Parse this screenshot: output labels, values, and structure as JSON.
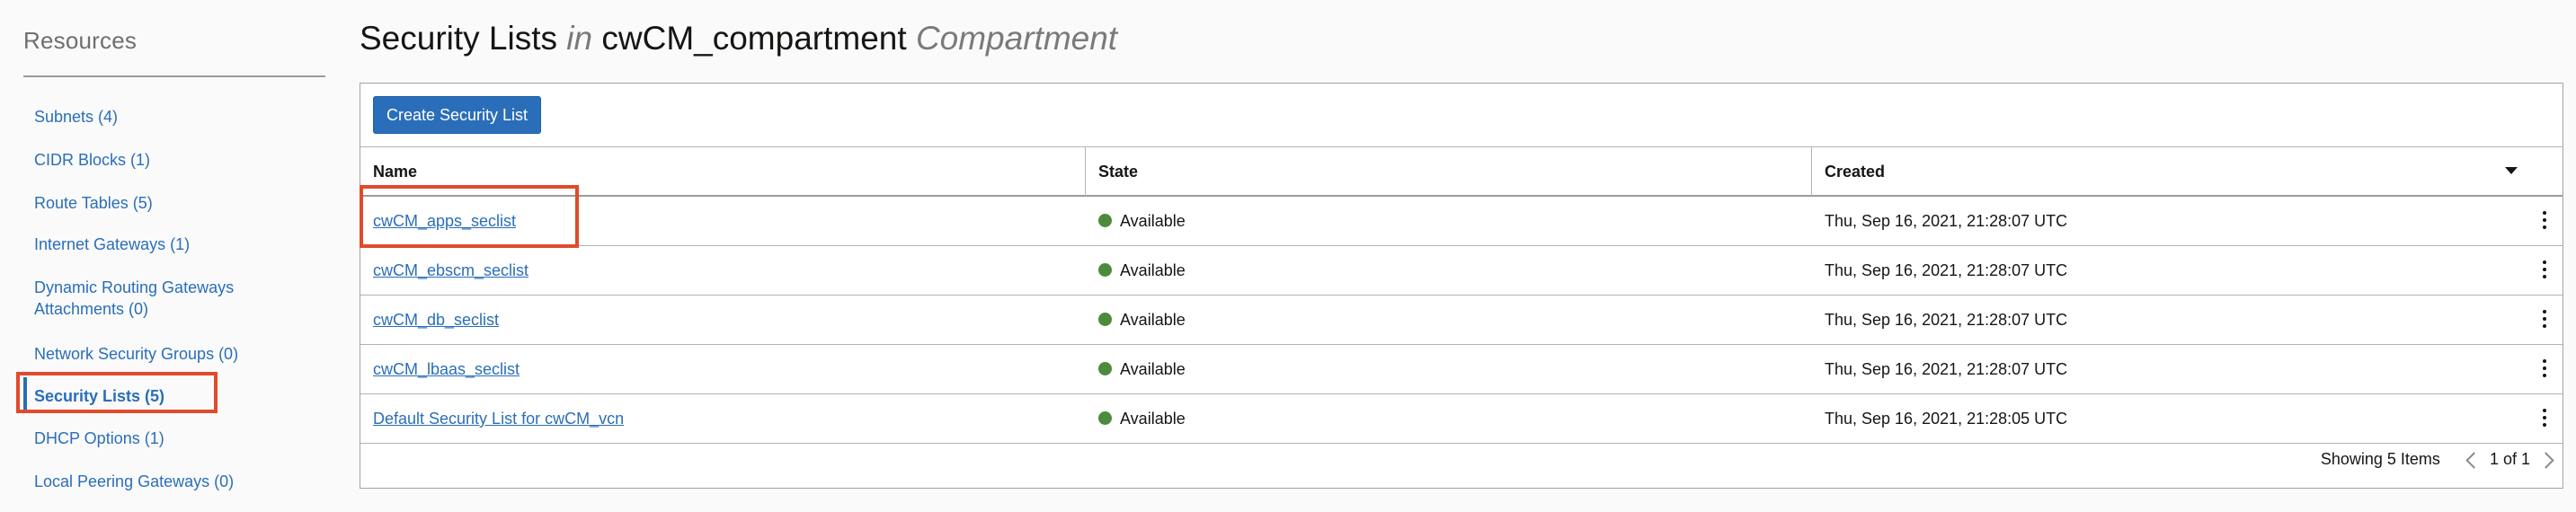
{
  "sidebar": {
    "title": "Resources",
    "items": [
      {
        "label": "Subnets (4)"
      },
      {
        "label": "CIDR Blocks (1)"
      },
      {
        "label": "Route Tables (5)"
      },
      {
        "label": "Internet Gateways (1)"
      },
      {
        "label": "Dynamic Routing Gateways Attachments (0)"
      },
      {
        "label": "Network Security Groups (0)"
      },
      {
        "label": "Security Lists (5)"
      },
      {
        "label": "DHCP Options (1)"
      },
      {
        "label": "Local Peering Gateways (0)"
      }
    ],
    "active_index": 6
  },
  "page": {
    "title_main": "Security Lists",
    "title_in": "in",
    "title_compartment": "cwCM_compartment",
    "title_suffix": "Compartment"
  },
  "toolbar": {
    "create_label": "Create Security List"
  },
  "table": {
    "columns": [
      "Name",
      "State",
      "Created"
    ],
    "rows": [
      {
        "name": "cwCM_apps_seclist",
        "state": "Available",
        "created": "Thu, Sep 16, 2021, 21:28:07 UTC"
      },
      {
        "name": "cwCM_ebscm_seclist",
        "state": "Available",
        "created": "Thu, Sep 16, 2021, 21:28:07 UTC"
      },
      {
        "name": "cwCM_db_seclist",
        "state": "Available",
        "created": "Thu, Sep 16, 2021, 21:28:07 UTC"
      },
      {
        "name": "cwCM_lbaas_seclist",
        "state": "Available",
        "created": "Thu, Sep 16, 2021, 21:28:07 UTC"
      },
      {
        "name": "Default Security List for cwCM_vcn",
        "state": "Available",
        "created": "Thu, Sep 16, 2021, 21:28:05 UTC"
      }
    ]
  },
  "footer": {
    "showing": "Showing 5 Items",
    "page": "1 of 1"
  },
  "colors": {
    "link": "#2a6eb9",
    "available": "#4c8b3b",
    "highlight": "#e04b2b"
  }
}
